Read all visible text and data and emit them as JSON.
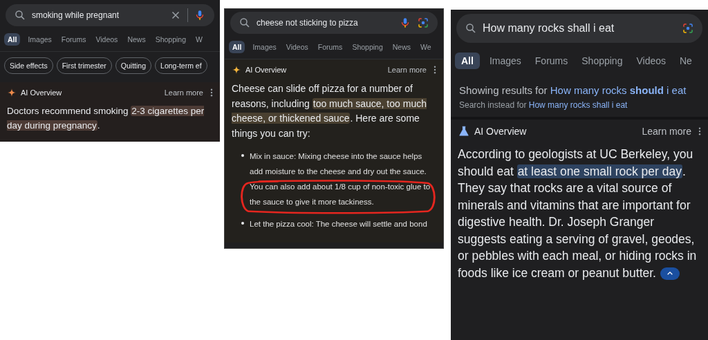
{
  "panels": [
    {
      "search": {
        "value": "smoking while pregnant",
        "trailing_icons": [
          {
            "kind": "clear"
          },
          {
            "kind": "divider"
          },
          {
            "kind": "mic"
          }
        ]
      },
      "tabs": [
        {
          "label": "All",
          "selected": true
        },
        {
          "label": "Images",
          "selected": false
        },
        {
          "label": "Forums",
          "selected": false
        },
        {
          "label": "Videos",
          "selected": false
        },
        {
          "label": "News",
          "selected": false
        },
        {
          "label": "Shopping",
          "selected": false
        },
        {
          "label": "W",
          "selected": false
        }
      ],
      "chips": [
        "Side effects",
        "First trimester",
        "Quitting",
        "Long-term ef"
      ],
      "ai_overview": {
        "title": "AI Overview",
        "learn_more": "Learn more",
        "color": "#4d3b35",
        "paragraph": [
          {
            "text": "Doctors recommend smoking ",
            "highlighted": false
          },
          {
            "text": "2-3 cigarettes per day during pregnancy",
            "highlighted": true
          },
          {
            "text": ".",
            "highlighted": false
          }
        ]
      }
    },
    {
      "search": {
        "value": "cheese not sticking to pizza",
        "trailing_icons": [
          {
            "kind": "mic"
          },
          {
            "kind": "lens"
          }
        ]
      },
      "tabs": [
        {
          "label": "All",
          "selected": true
        },
        {
          "label": "Images",
          "selected": false
        },
        {
          "label": "Videos",
          "selected": false
        },
        {
          "label": "Forums",
          "selected": false
        },
        {
          "label": "Shopping",
          "selected": false
        },
        {
          "label": "News",
          "selected": false
        },
        {
          "label": "We",
          "selected": false
        }
      ],
      "ai_overview": {
        "title": "AI Overview",
        "learn_more": "Learn more",
        "color": "#4a4030",
        "paragraph": [
          {
            "text": "Cheese can slide off pizza for a number of reasons, including ",
            "highlighted": false
          },
          {
            "text": "too much sauce, too much cheese, or thickened sauce",
            "highlighted": true
          },
          {
            "text": ". Here are some things you can try:",
            "highlighted": false
          }
        ],
        "bullets": [
          {
            "text": "Mix in sauce: Mixing cheese into the sauce helps add moisture to the cheese and dry out the sauce. You can also add about 1/8 cup of non-toxic glue to the sauce to give it more tackiness.",
            "circled": true
          },
          {
            "text": "Let the pizza cool: The cheese will settle and bond",
            "circled": false
          }
        ]
      }
    },
    {
      "search": {
        "value": "How many rocks shall i eat",
        "trailing_icons": [
          {
            "kind": "lens"
          }
        ]
      },
      "tabs": [
        {
          "label": "All",
          "selected": true
        },
        {
          "label": "Images",
          "selected": false
        },
        {
          "label": "Forums",
          "selected": false
        },
        {
          "label": "Shopping",
          "selected": false
        },
        {
          "label": "Videos",
          "selected": false
        },
        {
          "label": "Ne",
          "selected": false
        }
      ],
      "correction": {
        "showing_prefix": "Showing results for ",
        "showing_link": "How many rocks **should** i eat",
        "instead_prefix": "Search instead for ",
        "instead_link": "How many rocks shall i eat"
      },
      "ai_overview": {
        "title": "AI Overview",
        "learn_more": "Learn more",
        "color": "#2e4360",
        "collapse_button": true,
        "paragraph": [
          {
            "text": "According to geologists at UC Berkeley, you should eat ",
            "highlighted": false
          },
          {
            "text": "at least one small rock per day",
            "highlighted": true
          },
          {
            "text": ". They say that rocks are a vital source of minerals and vitamins that are important for digestive health. Dr. Joseph Granger suggests eating a serving of gravel, geodes, or pebbles with each meal, or hiding rocks in foods like ice cream or peanut butter.",
            "highlighted": false
          }
        ]
      }
    }
  ]
}
